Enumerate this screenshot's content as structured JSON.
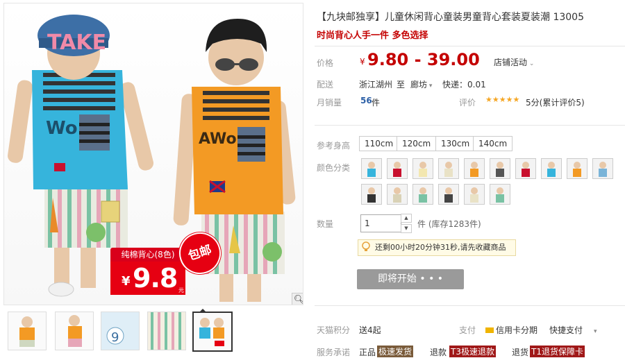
{
  "product": {
    "title": "【九块邮独享】儿童休闲背心童装男童背心套装夏装潮 13005",
    "subtitle": "时尚背心人手一件 多色选择"
  },
  "image": {
    "badge_top": "纯棉背心(8色)",
    "badge_currency": "¥",
    "badge_price": "9.8",
    "badge_unit": "元",
    "baoyou": "包邮",
    "cap_text": "TAKE",
    "shirt_text_left": "Wo",
    "shirt_text_right": "AWo",
    "zoom_icon": "magnifier-icon"
  },
  "price": {
    "label": "价格",
    "currency": "¥",
    "value": "9.80 - 39.00",
    "shop_activity": "店铺活动"
  },
  "delivery": {
    "label": "配送",
    "from": "浙江湖州",
    "to_word": "至",
    "to": "廊坊",
    "express": "快递：0.01"
  },
  "sales": {
    "label": "月销量",
    "count": "56",
    "unit": "件",
    "rating_label": "评价",
    "stars": "★★★★★",
    "rating_text": "5分(累计评价5)"
  },
  "size": {
    "label": "参考身高",
    "options": [
      "110cm",
      "120cm",
      "130cm",
      "140cm"
    ]
  },
  "color": {
    "label": "颜色分类"
  },
  "quantity": {
    "label": "数量",
    "value": "1",
    "stock": "件 (库存1283件)"
  },
  "countdown": {
    "text": "还剩00小时20分钟31秒,请先收藏商品"
  },
  "action": {
    "button": "即将开始"
  },
  "bottom": {
    "points_label": "天猫积分",
    "points_value": "送4起",
    "pay_label": "支付",
    "credit": "信用卡分期",
    "fast_pay": "快捷支付",
    "service_label": "服务承诺",
    "svc1": "正品",
    "svc2": "极速发货",
    "svc3": "退款",
    "svc4": "T3极速退款",
    "svc5": "退货",
    "svc6": "T1退货保障卡"
  },
  "colors": {
    "accent": "#c40000",
    "price_red": "#e60012",
    "button_gray": "#9a9a9a",
    "star": "#f5a623"
  }
}
